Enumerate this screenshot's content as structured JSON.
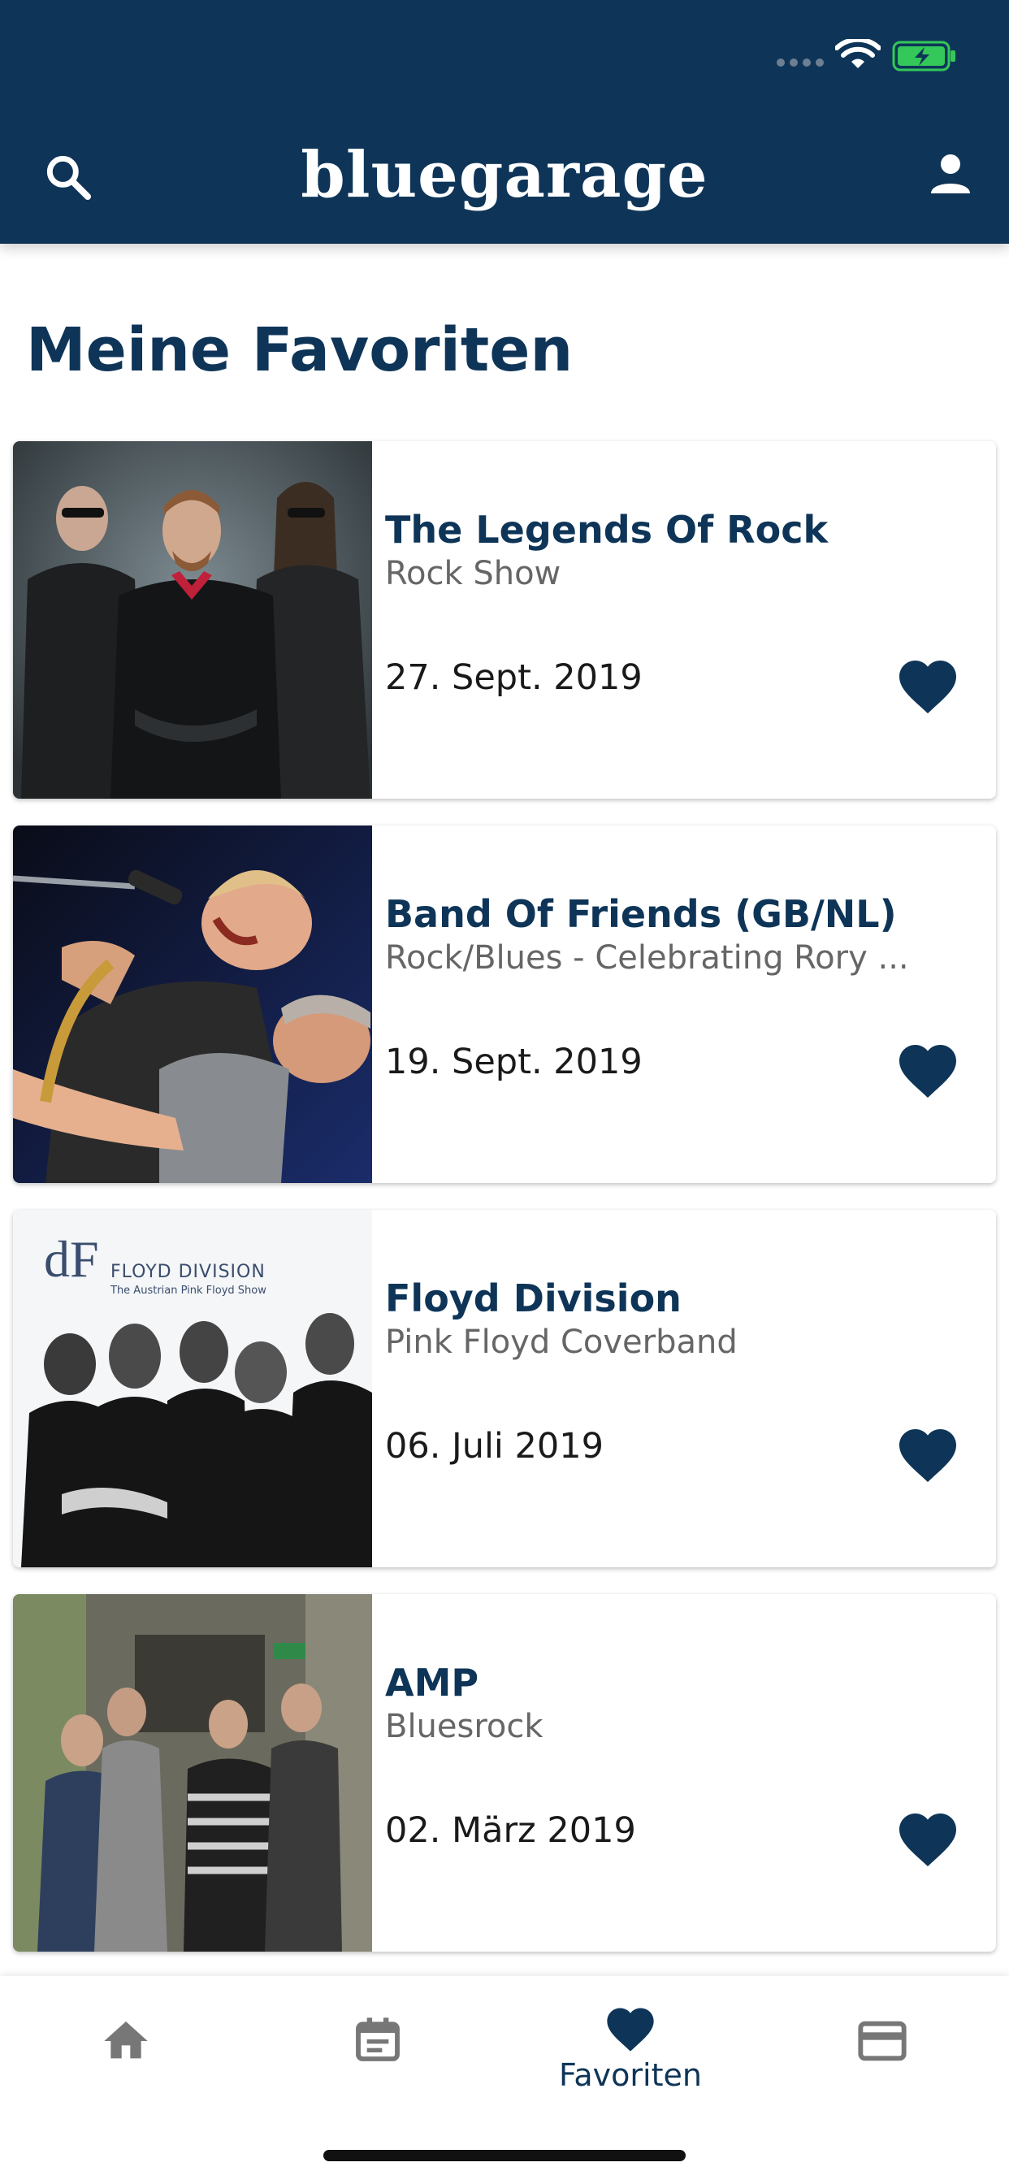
{
  "header": {
    "logo_text": "bluegarage",
    "search_icon": "search-icon",
    "profile_icon": "person-icon",
    "background_color": "#0e3558"
  },
  "page": {
    "title": "Meine Favoriten"
  },
  "favorites": [
    {
      "title": "The Legends Of Rock",
      "subtitle": "Rock Show",
      "date": "27. Sept. 2019",
      "image_icon": "band-photo"
    },
    {
      "title": "Band Of Friends (GB/NL)",
      "subtitle": "Rock/Blues - Celebrating Rory ...",
      "date": "19. Sept. 2019",
      "image_icon": "band-photo"
    },
    {
      "title": "Floyd Division",
      "subtitle": "Pink Floyd Coverband",
      "date": "06. Juli 2019",
      "image_icon": "band-photo",
      "image_text": "FLOYD DIVISION",
      "image_subtext": "The Austrian Pink Floyd Show"
    },
    {
      "title": "AMP",
      "subtitle": "Bluesrock",
      "date": "02. März 2019",
      "image_icon": "band-photo"
    }
  ],
  "bottom_nav": {
    "items": [
      {
        "icon": "home-icon",
        "label": ""
      },
      {
        "icon": "calendar-icon",
        "label": ""
      },
      {
        "icon": "heart-icon",
        "label": "Favoriten",
        "active": true
      },
      {
        "icon": "credit-card-icon",
        "label": ""
      }
    ]
  },
  "colors": {
    "primary": "#0e3558",
    "inactive_icon": "#777777",
    "battery_green": "#34c759"
  }
}
